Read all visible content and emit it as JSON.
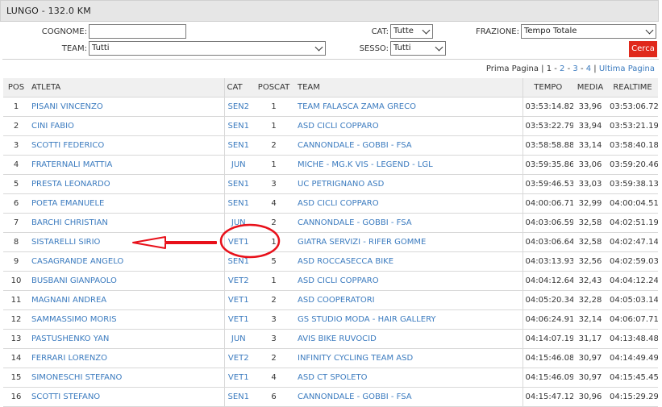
{
  "header": {
    "title": "LUNGO - 132.0 KM"
  },
  "filters": {
    "cognome_label": "COGNOME:",
    "cognome_value": "",
    "team_label": "TEAM:",
    "team_value": "Tutti",
    "cat_label": "CAT:",
    "cat_value": "Tutte",
    "sesso_label": "SESSO:",
    "sesso_value": "Tutti",
    "frazione_label": "FRAZIONE:",
    "frazione_value": "Tempo Totale",
    "search_button": "Cerca"
  },
  "pager": {
    "first": "Prima Pagina",
    "sep": " | ",
    "current": "1",
    "pages": [
      "2",
      "3",
      "4"
    ],
    "last": "Ultima Pagina"
  },
  "table": {
    "columns": [
      "POS",
      "ATLETA",
      "CAT",
      "POSCAT",
      "TEAM",
      "TEMPO",
      "MEDIA",
      "REALTIME"
    ],
    "rows": [
      [
        "1",
        "PISANI VINCENZO",
        "SEN2",
        "1",
        "TEAM FALASCA ZAMA GRECO",
        "03:53:14.82",
        "33,96",
        "03:53:06.72"
      ],
      [
        "2",
        "CINI FABIO",
        "SEN1",
        "1",
        "ASD CICLI COPPARO",
        "03:53:22.79",
        "33,94",
        "03:53:21.19"
      ],
      [
        "3",
        "SCOTTI FEDERICO",
        "SEN1",
        "2",
        "CANNONDALE - GOBBI - FSA",
        "03:58:58.88",
        "33,14",
        "03:58:40.18"
      ],
      [
        "4",
        "FRATERNALI MATTIA",
        "JUN",
        "1",
        "MICHE - MG.K VIS - LEGEND - LGL",
        "03:59:35.86",
        "33,06",
        "03:59:20.46"
      ],
      [
        "5",
        "PRESTA LEONARDO",
        "SEN1",
        "3",
        "UC PETRIGNANO ASD",
        "03:59:46.53",
        "33,03",
        "03:59:38.13"
      ],
      [
        "6",
        "POETA EMANUELE",
        "SEN1",
        "4",
        "ASD CICLI COPPARO",
        "04:00:06.71",
        "32,99",
        "04:00:04.51"
      ],
      [
        "7",
        "BARCHI CHRISTIAN",
        "JUN",
        "2",
        "CANNONDALE - GOBBI - FSA",
        "04:03:06.59",
        "32,58",
        "04:02:51.19"
      ],
      [
        "8",
        "SISTARELLI SIRIO",
        "VET1",
        "1",
        "GIATRA SERVIZI - RIFER GOMME",
        "04:03:06.64",
        "32,58",
        "04:02:47.14"
      ],
      [
        "9",
        "CASAGRANDE ANGELO",
        "SEN1",
        "5",
        "ASD ROCCASECCA BIKE",
        "04:03:13.93",
        "32,56",
        "04:02:59.03"
      ],
      [
        "10",
        "BUSBANI GIANPAOLO",
        "VET2",
        "1",
        "ASD CICLI COPPARO",
        "04:04:12.64",
        "32,43",
        "04:04:12.24"
      ],
      [
        "11",
        "MAGNANI ANDREA",
        "VET1",
        "2",
        "ASD COOPERATORI",
        "04:05:20.34",
        "32,28",
        "04:05:03.14"
      ],
      [
        "12",
        "SAMMASSIMO MORIS",
        "VET1",
        "3",
        "GS STUDIO MODA - HAIR GALLERY",
        "04:06:24.91",
        "32,14",
        "04:06:07.71"
      ],
      [
        "13",
        "PASTUSHENKO YAN",
        "JUN",
        "3",
        "AVIS BIKE RUVOCID",
        "04:14:07.19",
        "31,17",
        "04:13:48.48"
      ],
      [
        "14",
        "FERRARI LORENZO",
        "VET2",
        "2",
        "INFINITY CYCLING TEAM ASD",
        "04:15:46.08",
        "30,97",
        "04:14:49.49"
      ],
      [
        "15",
        "SIMONESCHI STEFANO",
        "VET1",
        "4",
        "ASD CT SPOLETO",
        "04:15:46.09",
        "30,97",
        "04:15:45.45"
      ],
      [
        "16",
        "SCOTTI STEFANO",
        "SEN1",
        "6",
        "CANNONDALE - GOBBI - FSA",
        "04:15:47.12",
        "30,96",
        "04:15:29.29"
      ]
    ]
  },
  "annotation": {
    "color": "#e8101a",
    "highlighted_row": "8"
  }
}
